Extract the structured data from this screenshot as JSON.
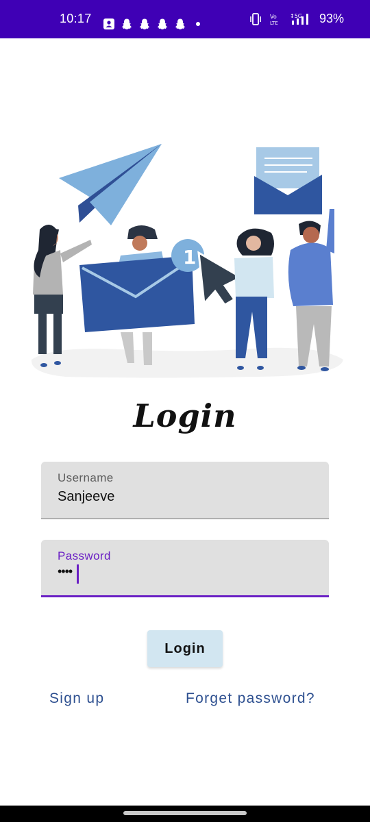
{
  "status_bar": {
    "time": "10:17",
    "battery": "93%",
    "notification_icons": [
      "contact-card-icon",
      "snapchat-icon",
      "snapchat-icon",
      "snapchat-icon",
      "snapchat-icon",
      "more-dot-icon"
    ],
    "right_icons": [
      "vibrate-icon",
      "volte-icon",
      "5g-signal-icon"
    ]
  },
  "screen": {
    "title": "Login"
  },
  "form": {
    "username": {
      "label": "Username",
      "value": "Sanjeeve"
    },
    "password": {
      "label": "Password",
      "value": "••••"
    },
    "submit_label": "Login"
  },
  "links": {
    "signup": "Sign up",
    "forgot": "Forget password?"
  },
  "illustration": {
    "badge": "1"
  },
  "colors": {
    "status_bar": "#3f00b5",
    "accent": "#6a1fc4",
    "link": "#2e5090",
    "button": "#d2e6f1",
    "field_bg": "#e0e0e0"
  }
}
